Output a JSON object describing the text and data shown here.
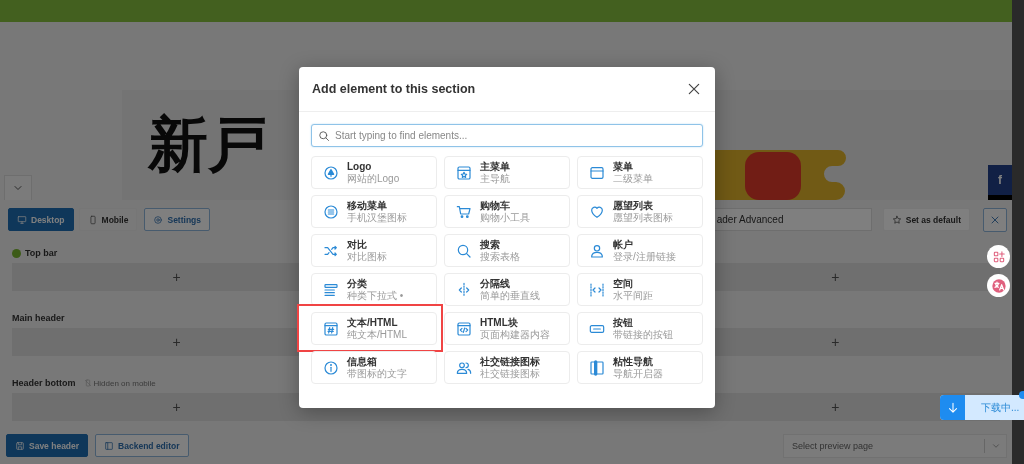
{
  "banner": {
    "title": "新戸",
    "social_button": "f"
  },
  "view_tabs": [
    {
      "label": "Desktop",
      "selected": true
    },
    {
      "label": "Mobile",
      "selected": false
    }
  ],
  "settings_button": "Settings",
  "header_name": "ader Advanced",
  "set_default_button": "Set as default",
  "sections": [
    {
      "label": "Top bar",
      "active": true,
      "add_buttons": [
        "+",
        "+"
      ]
    },
    {
      "label": "Main header",
      "active": false,
      "add_buttons": [
        "+",
        "+"
      ]
    },
    {
      "label": "Header bottom",
      "active": false,
      "note": "Hidden on mobile",
      "add_buttons": [
        "+",
        "+"
      ]
    }
  ],
  "footer": {
    "save_button": "Save header",
    "backend_button": "Backend editor",
    "preview_select": {
      "placeholder": "Select preview page"
    }
  },
  "download": {
    "label": "下载中..."
  },
  "modal": {
    "title": "Add element to this section",
    "search": {
      "placeholder": "Start typing to find elements..."
    },
    "elements": [
      {
        "title": "Logo",
        "subtitle": "网站的Logo",
        "highlighted": false
      },
      {
        "title": "主菜单",
        "subtitle": "主导航",
        "highlighted": false
      },
      {
        "title": "菜单",
        "subtitle": "二级菜单",
        "highlighted": false
      },
      {
        "title": "移动菜单",
        "subtitle": "手机汉堡图标",
        "highlighted": false
      },
      {
        "title": "购物车",
        "subtitle": "购物小工具",
        "highlighted": false
      },
      {
        "title": "愿望列表",
        "subtitle": "愿望列表图标",
        "highlighted": false
      },
      {
        "title": "对比",
        "subtitle": "对比图标",
        "highlighted": false
      },
      {
        "title": "搜索",
        "subtitle": "搜索表格",
        "highlighted": false
      },
      {
        "title": "帐户",
        "subtitle": "登录/注册链接",
        "highlighted": false
      },
      {
        "title": "分类",
        "subtitle": "种类下拉式 •",
        "highlighted": false
      },
      {
        "title": "分隔线",
        "subtitle": "简单的垂直线",
        "highlighted": false
      },
      {
        "title": "空间",
        "subtitle": "水平间距",
        "highlighted": false
      },
      {
        "title": "文本/HTML",
        "subtitle": "纯文本/HTML",
        "highlighted": true
      },
      {
        "title": "HTML块",
        "subtitle": "页面构建器内容",
        "highlighted": false
      },
      {
        "title": "按钮",
        "subtitle": "带链接的按钮",
        "highlighted": false
      },
      {
        "title": "信息箱",
        "subtitle": "带图标的文字",
        "highlighted": false
      },
      {
        "title": "社交链接图标",
        "subtitle": "社交链接图标",
        "highlighted": false
      },
      {
        "title": "粘性导航",
        "subtitle": "导航开启器",
        "highlighted": false
      }
    ]
  }
}
